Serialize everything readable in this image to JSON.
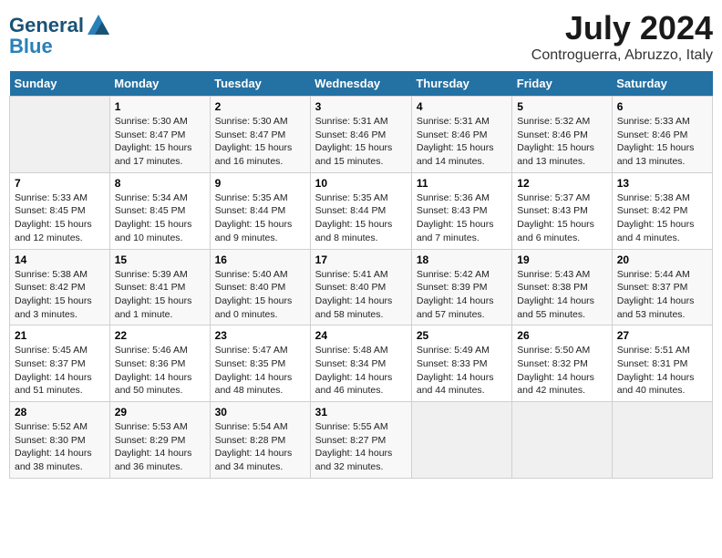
{
  "logo": {
    "text_general": "General",
    "text_blue": "Blue"
  },
  "title": "July 2024",
  "subtitle": "Controguerra, Abruzzo, Italy",
  "days_of_week": [
    "Sunday",
    "Monday",
    "Tuesday",
    "Wednesday",
    "Thursday",
    "Friday",
    "Saturday"
  ],
  "weeks": [
    [
      {
        "day": "",
        "info": ""
      },
      {
        "day": "1",
        "info": "Sunrise: 5:30 AM\nSunset: 8:47 PM\nDaylight: 15 hours\nand 17 minutes."
      },
      {
        "day": "2",
        "info": "Sunrise: 5:30 AM\nSunset: 8:47 PM\nDaylight: 15 hours\nand 16 minutes."
      },
      {
        "day": "3",
        "info": "Sunrise: 5:31 AM\nSunset: 8:46 PM\nDaylight: 15 hours\nand 15 minutes."
      },
      {
        "day": "4",
        "info": "Sunrise: 5:31 AM\nSunset: 8:46 PM\nDaylight: 15 hours\nand 14 minutes."
      },
      {
        "day": "5",
        "info": "Sunrise: 5:32 AM\nSunset: 8:46 PM\nDaylight: 15 hours\nand 13 minutes."
      },
      {
        "day": "6",
        "info": "Sunrise: 5:33 AM\nSunset: 8:46 PM\nDaylight: 15 hours\nand 13 minutes."
      }
    ],
    [
      {
        "day": "7",
        "info": "Sunrise: 5:33 AM\nSunset: 8:45 PM\nDaylight: 15 hours\nand 12 minutes."
      },
      {
        "day": "8",
        "info": "Sunrise: 5:34 AM\nSunset: 8:45 PM\nDaylight: 15 hours\nand 10 minutes."
      },
      {
        "day": "9",
        "info": "Sunrise: 5:35 AM\nSunset: 8:44 PM\nDaylight: 15 hours\nand 9 minutes."
      },
      {
        "day": "10",
        "info": "Sunrise: 5:35 AM\nSunset: 8:44 PM\nDaylight: 15 hours\nand 8 minutes."
      },
      {
        "day": "11",
        "info": "Sunrise: 5:36 AM\nSunset: 8:43 PM\nDaylight: 15 hours\nand 7 minutes."
      },
      {
        "day": "12",
        "info": "Sunrise: 5:37 AM\nSunset: 8:43 PM\nDaylight: 15 hours\nand 6 minutes."
      },
      {
        "day": "13",
        "info": "Sunrise: 5:38 AM\nSunset: 8:42 PM\nDaylight: 15 hours\nand 4 minutes."
      }
    ],
    [
      {
        "day": "14",
        "info": "Sunrise: 5:38 AM\nSunset: 8:42 PM\nDaylight: 15 hours\nand 3 minutes."
      },
      {
        "day": "15",
        "info": "Sunrise: 5:39 AM\nSunset: 8:41 PM\nDaylight: 15 hours\nand 1 minute."
      },
      {
        "day": "16",
        "info": "Sunrise: 5:40 AM\nSunset: 8:40 PM\nDaylight: 15 hours\nand 0 minutes."
      },
      {
        "day": "17",
        "info": "Sunrise: 5:41 AM\nSunset: 8:40 PM\nDaylight: 14 hours\nand 58 minutes."
      },
      {
        "day": "18",
        "info": "Sunrise: 5:42 AM\nSunset: 8:39 PM\nDaylight: 14 hours\nand 57 minutes."
      },
      {
        "day": "19",
        "info": "Sunrise: 5:43 AM\nSunset: 8:38 PM\nDaylight: 14 hours\nand 55 minutes."
      },
      {
        "day": "20",
        "info": "Sunrise: 5:44 AM\nSunset: 8:37 PM\nDaylight: 14 hours\nand 53 minutes."
      }
    ],
    [
      {
        "day": "21",
        "info": "Sunrise: 5:45 AM\nSunset: 8:37 PM\nDaylight: 14 hours\nand 51 minutes."
      },
      {
        "day": "22",
        "info": "Sunrise: 5:46 AM\nSunset: 8:36 PM\nDaylight: 14 hours\nand 50 minutes."
      },
      {
        "day": "23",
        "info": "Sunrise: 5:47 AM\nSunset: 8:35 PM\nDaylight: 14 hours\nand 48 minutes."
      },
      {
        "day": "24",
        "info": "Sunrise: 5:48 AM\nSunset: 8:34 PM\nDaylight: 14 hours\nand 46 minutes."
      },
      {
        "day": "25",
        "info": "Sunrise: 5:49 AM\nSunset: 8:33 PM\nDaylight: 14 hours\nand 44 minutes."
      },
      {
        "day": "26",
        "info": "Sunrise: 5:50 AM\nSunset: 8:32 PM\nDaylight: 14 hours\nand 42 minutes."
      },
      {
        "day": "27",
        "info": "Sunrise: 5:51 AM\nSunset: 8:31 PM\nDaylight: 14 hours\nand 40 minutes."
      }
    ],
    [
      {
        "day": "28",
        "info": "Sunrise: 5:52 AM\nSunset: 8:30 PM\nDaylight: 14 hours\nand 38 minutes."
      },
      {
        "day": "29",
        "info": "Sunrise: 5:53 AM\nSunset: 8:29 PM\nDaylight: 14 hours\nand 36 minutes."
      },
      {
        "day": "30",
        "info": "Sunrise: 5:54 AM\nSunset: 8:28 PM\nDaylight: 14 hours\nand 34 minutes."
      },
      {
        "day": "31",
        "info": "Sunrise: 5:55 AM\nSunset: 8:27 PM\nDaylight: 14 hours\nand 32 minutes."
      },
      {
        "day": "",
        "info": ""
      },
      {
        "day": "",
        "info": ""
      },
      {
        "day": "",
        "info": ""
      }
    ]
  ]
}
